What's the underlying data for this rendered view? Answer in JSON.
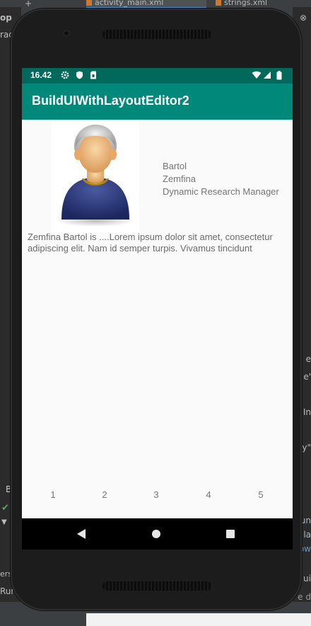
{
  "ide": {
    "tabs": [
      {
        "label": "activity_main.xml"
      },
      {
        "label": "strings.xml"
      }
    ],
    "left_fragments": [
      "op",
      "rad",
      "B",
      "ers",
      "Run"
    ],
    "right_fragments": [
      "e",
      "e'",
      "In",
      "y\"",
      "un",
      "la",
      "ow",
      "ui",
      "e d"
    ]
  },
  "statusbar": {
    "time": "16.42",
    "icons": [
      "settings-icon",
      "shield-icon",
      "sim-card-icon",
      "wifi-icon",
      "cell-signal-icon",
      "battery-icon"
    ]
  },
  "appbar": {
    "title": "BuildUIWithLayoutEditor2"
  },
  "profile": {
    "avatar_icon": "person-avatar",
    "first_name": "Bartol",
    "last_name": "Zemfina",
    "job_title": "Dynamic Research Manager",
    "bio": "Zemfina Bartol is ....Lorem ipsum dolor sit amet, consectetur adipiscing elit. Nam id semper turpis. Vivamus tincidunt"
  },
  "pagination": {
    "pages": [
      "1",
      "2",
      "3",
      "4",
      "5"
    ]
  },
  "navbar": {
    "icons": [
      "back-icon",
      "home-icon",
      "recent-apps-icon"
    ]
  },
  "colors": {
    "status_bar": "#00695c",
    "app_bar": "#00897b",
    "screen_bg": "#fafafa"
  }
}
